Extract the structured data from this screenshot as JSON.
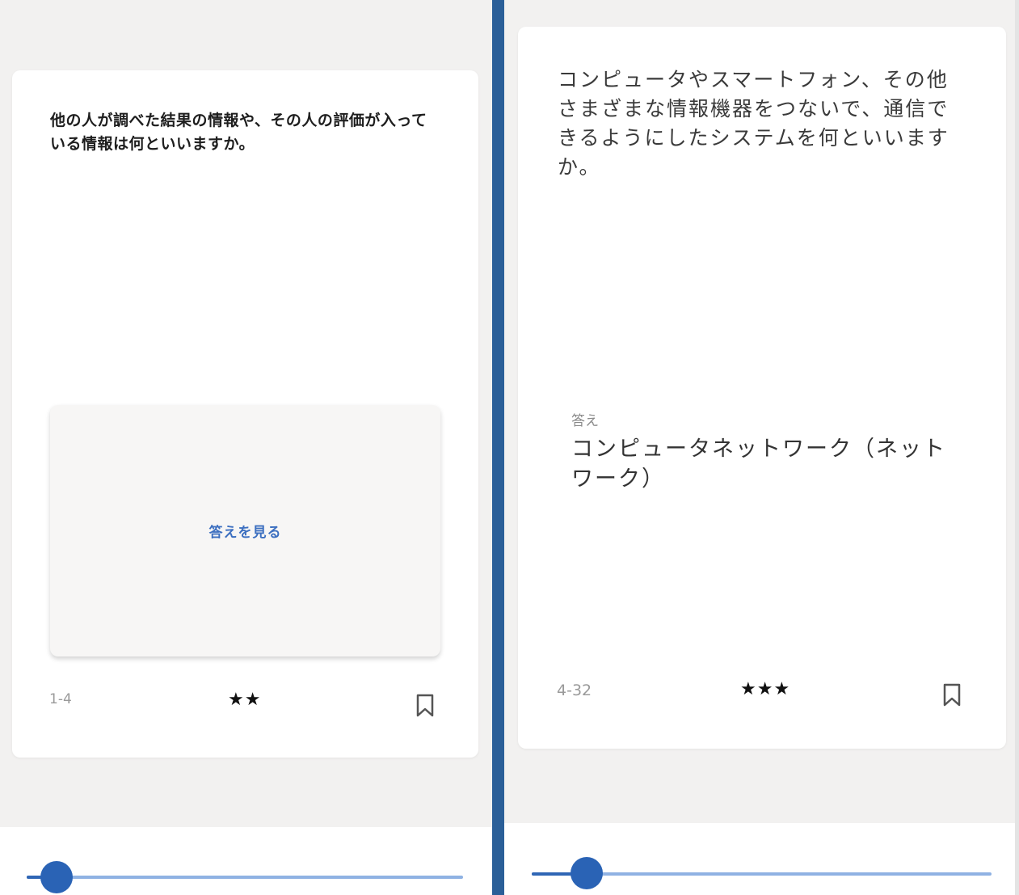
{
  "colors": {
    "accent": "#2a63b5",
    "divider": "#2b5f98",
    "background": "#f2f1f0",
    "card": "#ffffff",
    "link": "#3c6fc0"
  },
  "left_card": {
    "question": "他の人が調べた結果の情報や、その人の評価が入っている情報は何といいますか。",
    "show_answer_label": "答えを見る",
    "code": "1-4",
    "stars": "★★",
    "difficulty": 2,
    "bookmark_icon": "bookmark-icon"
  },
  "right_card": {
    "question": "コンピュータやスマートフォン、その他さまざまな情報機器をつないで、通信できるようにしたシステムを何といいますか。",
    "answer_caption": "答え",
    "answer": "コンピュータネットワーク（ネットワーク）",
    "code": "4-32",
    "stars": "★★★",
    "difficulty": 3,
    "bookmark_icon": "bookmark-icon"
  },
  "left_slider": {
    "value_fraction": 0.07
  },
  "right_slider": {
    "value_fraction": 0.12
  }
}
